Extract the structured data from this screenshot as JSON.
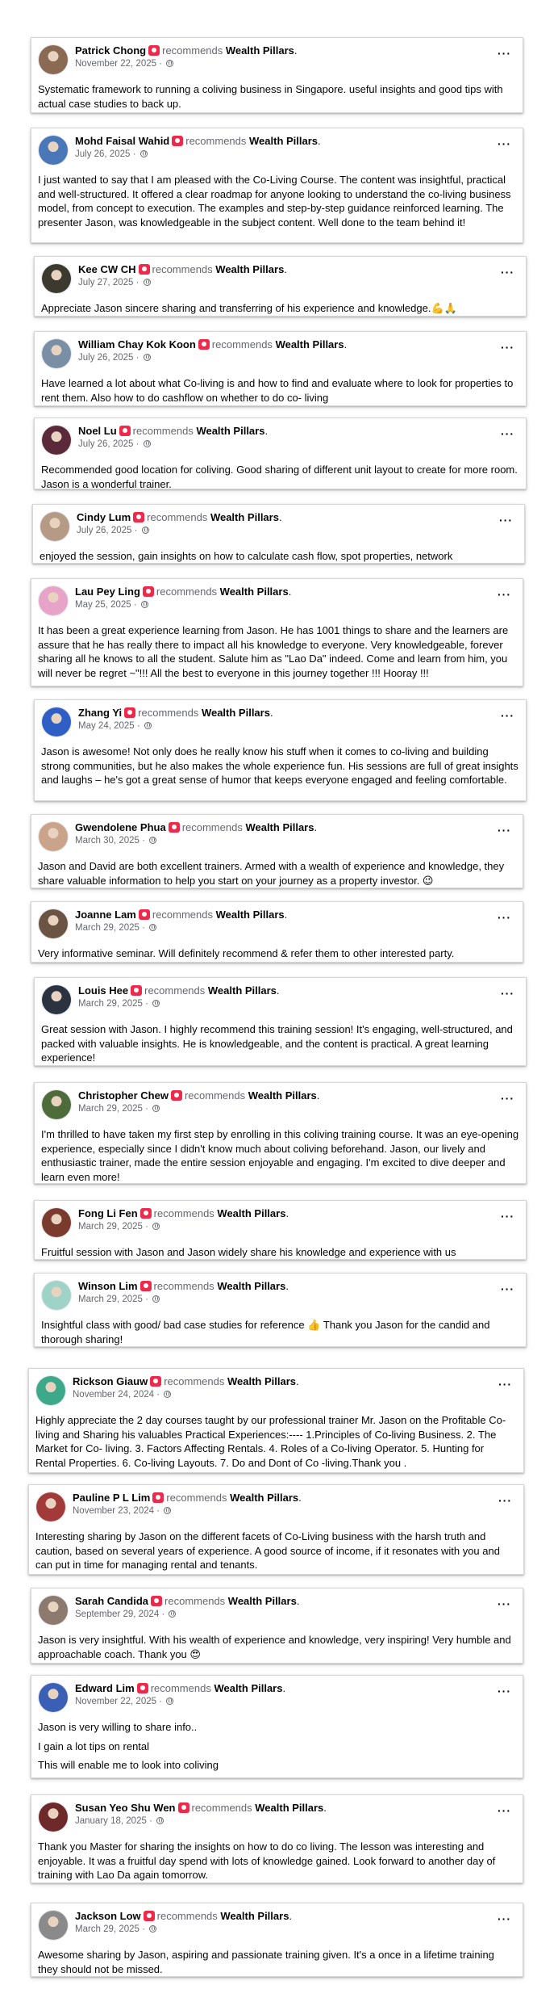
{
  "recommend_word": "recommends",
  "page_name": "Wealth Pillars",
  "privacy_icon": "globe-icon",
  "reviews": [
    {
      "name": "Patrick Chong",
      "date": "November 22, 2025",
      "avatar_color": "#8a6a52",
      "text": [
        "Systematic framework to running a coliving business in Singapore. useful insights and good tips with actual case studies to back up."
      ]
    },
    {
      "name": "Mohd Faisal Wahid",
      "date": "July 26, 2025",
      "avatar_color": "#4a77b8",
      "text": [
        "I just wanted to say that I am pleased with the Co-Living Course. The content was insightful, practical and well-structured. It offered a clear roadmap for anyone looking to understand the co-living business model, from concept to execution. The examples and step-by-step guidance reinforced learning. The presenter Jason, was knowledgeable in the subject content. Well done to the team behind it!"
      ]
    },
    {
      "name": "Kee CW CH",
      "date": "July 27, 2025",
      "avatar_color": "#3c3a2e",
      "text": [
        "Appreciate Jason sincere sharing and transferring of his experience and knowledge.💪🙏"
      ]
    },
    {
      "name": "William Chay Kok Koon",
      "date": "July 26, 2025",
      "avatar_color": "#7a8fa6",
      "text": [
        "Have learned a lot about what Co-living is and how to find and evaluate where to look for properties to rent them. Also how to do cashflow on whether to do co- living"
      ]
    },
    {
      "name": "Noel Lu",
      "date": "July 26, 2025",
      "avatar_color": "#5a2a3a",
      "text": [
        "Recommended good location for coliving. Good sharing of different unit layout to create for more room. Jason is a wonderful trainer."
      ]
    },
    {
      "name": "Cindy Lum",
      "date": "July 26, 2025",
      "avatar_color": "#b59a86",
      "text": [
        "enjoyed the session, gain insights on how to calculate cash flow, spot properties, network"
      ]
    },
    {
      "name": "Lau Pey Ling",
      "date": "May 25, 2025",
      "avatar_color": "#e8a4c8",
      "text": [
        "It has been a great experience learning from Jason. He has 1001 things to share and the learners are assure that he has really there to impact all his knowledge to everyone. Very knowledgeable, forever sharing all he knows to all the student. Salute him as \"Lao Da\" indeed. Come and learn from him, you will never be regret ~\"!!!  All the best to everyone in this journey together !!! Hooray !!!"
      ]
    },
    {
      "name": "Zhang Yi",
      "date": "May 24, 2025",
      "avatar_color": "#2f5fc4",
      "text": [
        "Jason is awesome! Not only does he really know his stuff when it comes to co-living and building strong communities, but he also makes the whole experience fun. His sessions are full of great insights and laughs – he's got a great sense of humor that keeps everyone engaged and feeling comfortable."
      ]
    },
    {
      "name": "Gwendolene Phua",
      "date": "March 30, 2025",
      "avatar_color": "#c9a48a",
      "text": [
        "Jason and David are both excellent trainers. Armed with a wealth of experience and knowledge, they share valuable information to help you start on your journey as a property investor. 😉"
      ]
    },
    {
      "name": "Joanne Lam",
      "date": "March 29, 2025",
      "avatar_color": "#6b5444",
      "text": [
        "Very informative seminar. Will definitely recommend & refer them to other interested party."
      ]
    },
    {
      "name": "Louis Hee",
      "date": "March 29, 2025",
      "avatar_color": "#2b3340",
      "text": [
        "Great session with Jason. I highly recommend this training session! It's engaging, well-structured, and packed with valuable insights. He is knowledgeable, and the content is practical. A great learning experience!"
      ]
    },
    {
      "name": "Christopher Chew",
      "date": "March 29, 2025",
      "avatar_color": "#4e6b3a",
      "text": [
        "I'm thrilled to have taken my first step by enrolling in this coliving training course. It was an eye-opening experience, especially since I didn't know much about coliving beforehand. Jason, our lively and enthusiastic trainer, made the entire session enjoyable and engaging. I'm excited to dive deeper and learn even more!"
      ]
    },
    {
      "name": "Fong Li Fen",
      "date": "March 29, 2025",
      "avatar_color": "#7a3b2e",
      "text": [
        "Fruitful session with Jason and Jason widely share his knowledge and experience with us"
      ]
    },
    {
      "name": "Winson Lim",
      "date": "March 29, 2025",
      "avatar_color": "#9fd3c7",
      "text": [
        "Insightful class with good/ bad case studies for reference 👍 Thank you Jason for the candid and thorough sharing!"
      ]
    },
    {
      "name": "Rickson Giauw",
      "date": "November 24, 2024",
      "avatar_color": "#3ea88a",
      "text": [
        "Highly appreciate the 2 day courses taught by our professional trainer Mr. Jason on the Profitable Co-living and Sharing his valuables Practical Experiences:----     1.Principles of Co-living Business. 2. The Market for Co- living. 3. Factors Affecting Rentals. 4. Roles of a Co-living Operator. 5. Hunting for Rental Properties. 6. Co-living Layouts. 7. Do and Dont of Co -living.Thank you ."
      ]
    },
    {
      "name": "Pauline P L Lim",
      "date": "November 23, 2024",
      "avatar_color": "#a33a3a",
      "text": [
        "Interesting sharing by Jason on the different facets of Co-Living business with the harsh truth and caution, based on several years of experience. A good source of income, if it resonates with you and can put in time for managing rental and tenants."
      ]
    },
    {
      "name": "Sarah Candida",
      "date": "September 29, 2024",
      "avatar_color": "#8c7a6e",
      "text": [
        "Jason is very insightful. With his wealth of experience and knowledge, very inspiring! Very humble and approachable coach. Thank you 😍"
      ]
    },
    {
      "name": "Edward Lim",
      "date": "November 22, 2025",
      "avatar_color": "#3b5fb5",
      "text": [
        "Jason is very willing to share info..",
        "I gain a lot tips on rental",
        "This will enable me to look into coliving"
      ]
    },
    {
      "name": "Susan Yeo Shu Wen",
      "date": "January 18, 2025",
      "avatar_color": "#6e2a2a",
      "text": [
        "Thank you Master for sharing the insights on how to do co living. The lesson was interesting and enjoyable. It was a fruitful day spend with lots of knowledge gained. Look forward to another day of training with Lao Da again tomorrow."
      ]
    },
    {
      "name": "Jackson Low",
      "date": "March 29, 2025",
      "avatar_color": "#8a8a8a",
      "text": [
        "Awesome sharing by Jason, aspiring and passionate training given. It's a once in a lifetime training they should not be missed."
      ]
    }
  ]
}
